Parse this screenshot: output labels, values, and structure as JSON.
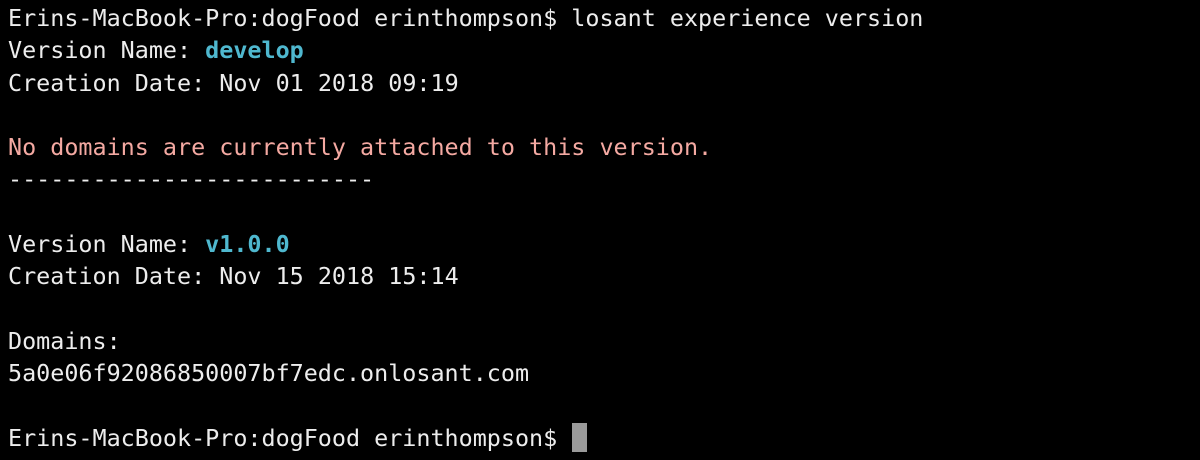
{
  "terminal": {
    "prompt": "Erins-MacBook-Pro:dogFood erinthompson$ ",
    "command": "losant experience version",
    "versions": [
      {
        "name_label": "Version Name: ",
        "name": "develop",
        "date_label": "Creation Date: ",
        "date": "Nov 01 2018 09:19",
        "domains_message": "No domains are currently attached to this version.",
        "separator": "--------------------------"
      },
      {
        "name_label": "Version Name: ",
        "name": "v1.0.0",
        "date_label": "Creation Date: ",
        "date": "Nov 15 2018 15:14",
        "domains_label": "Domains:",
        "domain": "5a0e06f92086850007bf7edc.onlosant.com"
      }
    ]
  },
  "colors": {
    "background": "#000000",
    "text": "#ededed",
    "version_name": "#4fb8cf",
    "warning": "#f4a9a2",
    "cursor": "#9a9a9a"
  }
}
